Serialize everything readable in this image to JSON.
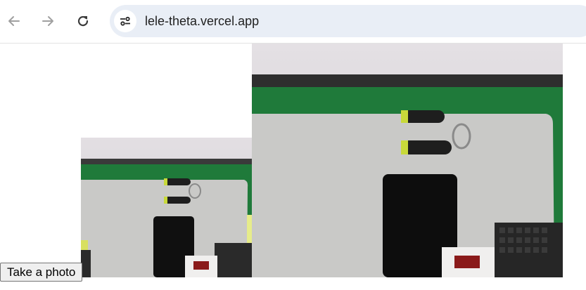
{
  "browser": {
    "url": "lele-theta.vercel.app",
    "icons": {
      "back": "arrow-left-icon",
      "forward": "arrow-right-icon",
      "reload": "reload-icon",
      "site_info": "tune-icon"
    }
  },
  "page": {
    "take_photo_label": "Take a photo",
    "images": [
      {
        "name": "captured-photo-small",
        "description_kind": "webcam snapshot"
      },
      {
        "name": "live-camera-view",
        "description_kind": "webcam feed"
      }
    ]
  },
  "colors": {
    "toolbar_bg": "#ffffff",
    "omnibox_bg": "#e9eef6",
    "board_green": "#1f7a3a",
    "mat_gray": "#c9c9c7",
    "wall": "#d9d7d9"
  }
}
